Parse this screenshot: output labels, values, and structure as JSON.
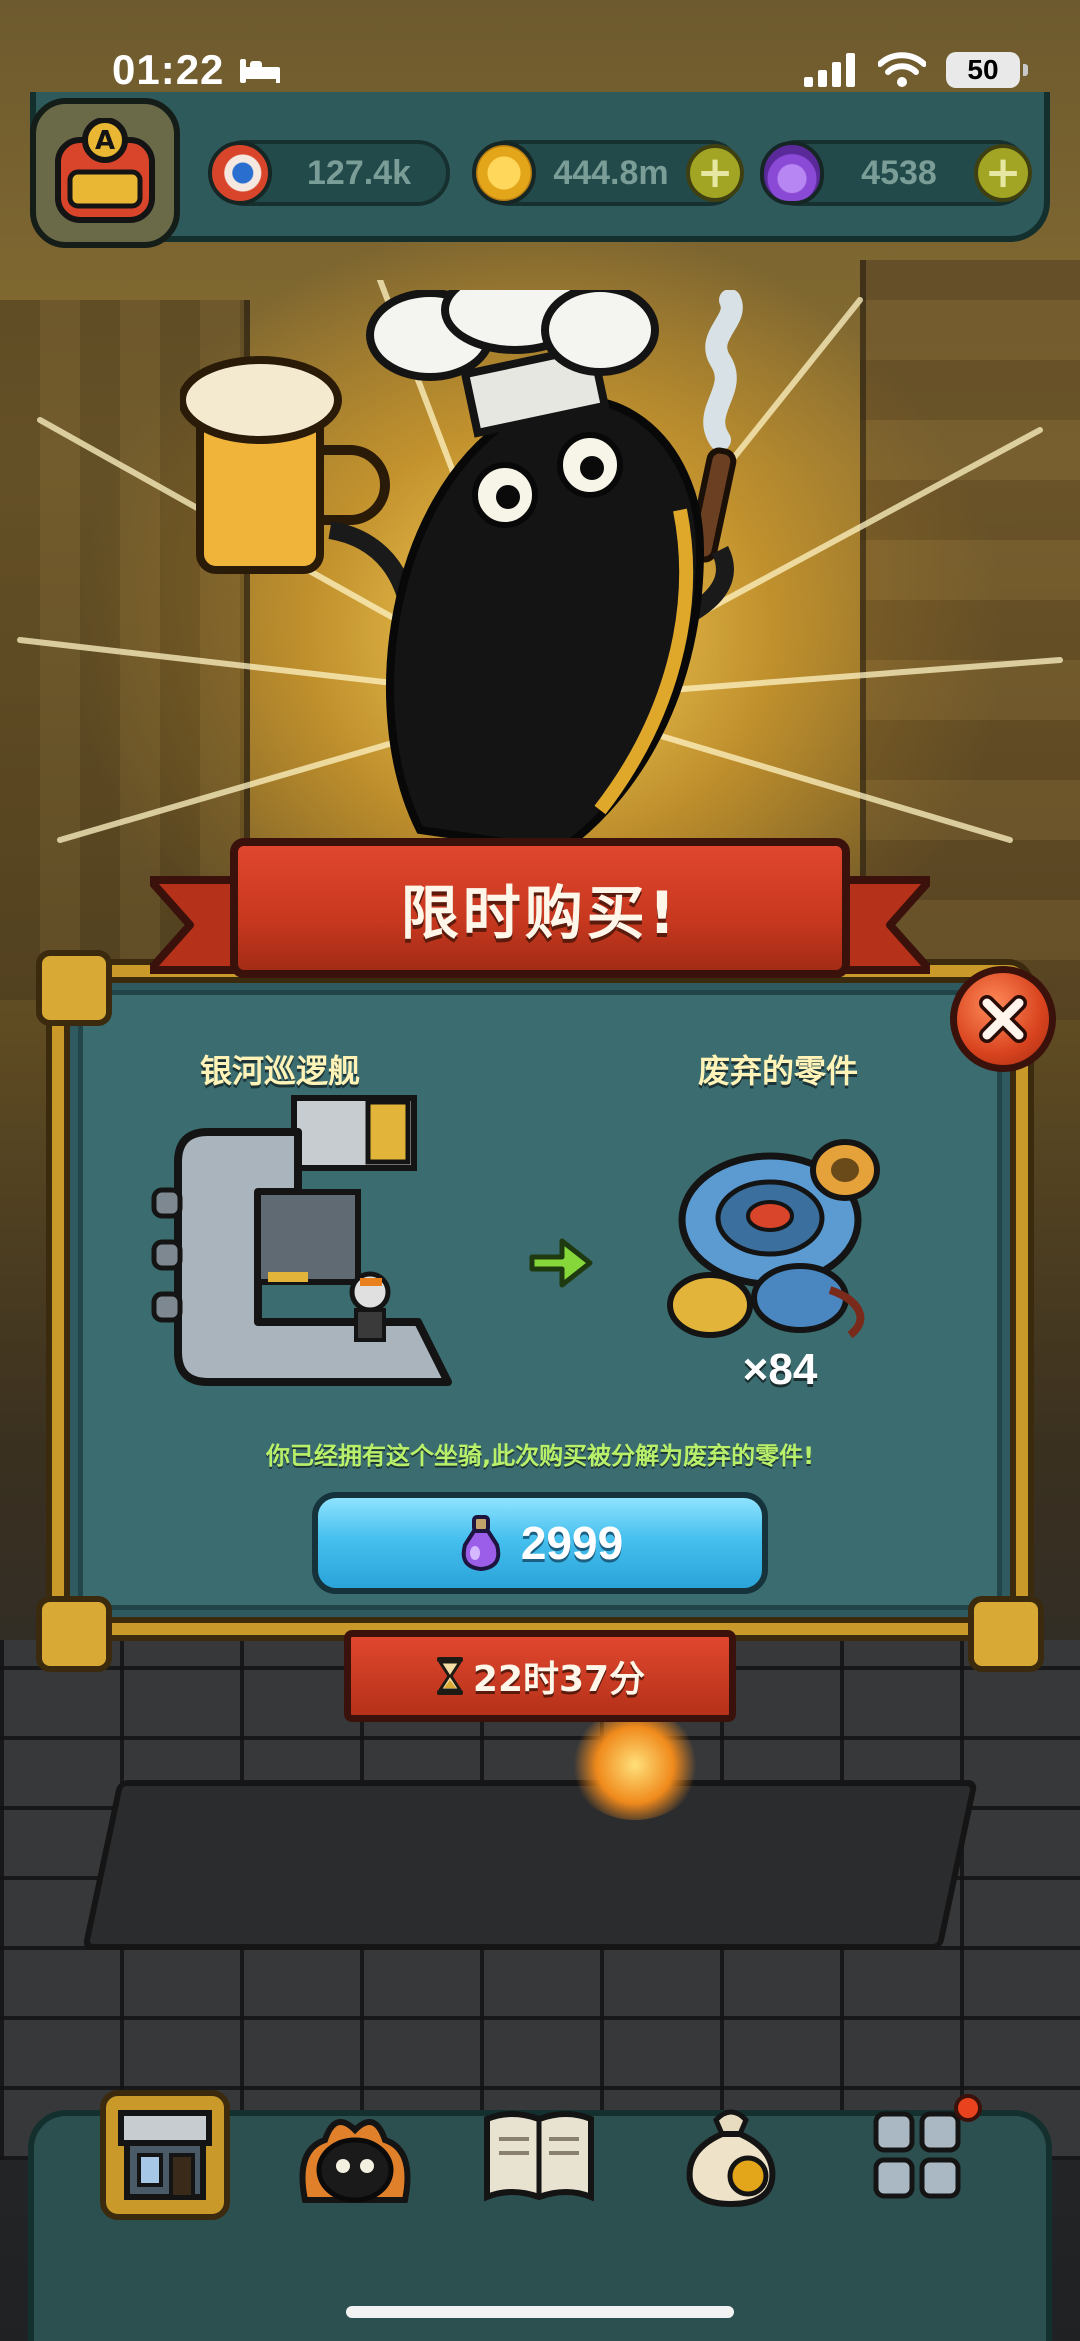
{
  "status_bar": {
    "time": "01:22",
    "battery": "50"
  },
  "resources": [
    {
      "id": "eyes",
      "value": "127.4k",
      "icon": "eyeball-icon",
      "color": "#d8452a",
      "has_plus": false
    },
    {
      "id": "coins",
      "value": "444.8m",
      "icon": "gold-coin-icon",
      "color": "#e3a61b",
      "has_plus": true
    },
    {
      "id": "potion",
      "value": "4538",
      "icon": "purple-potion-icon",
      "color": "#8a4ad6",
      "has_plus": true
    }
  ],
  "offer": {
    "title": "限时购买!",
    "item_name": "银河巡逻舰",
    "reward_name": "废弃的零件",
    "reward_quantity": "×84",
    "notice": "你已经拥有这个坐骑,此次购买被分解为废弃的零件!",
    "price": "2999",
    "price_icon": "purple-potion-icon",
    "timer": "22时37分",
    "timer_icon": "hourglass-icon"
  },
  "colors": {
    "banner_red": "#d8432a",
    "dialog_frame": "#c99a2a",
    "dialog_bg": "#3a6c70",
    "buy_button": "#46c0ee",
    "notice_green": "#b8f06a",
    "label_yellow": "#fff3b8"
  },
  "bottom_nav": [
    {
      "id": "shop",
      "icon": "shop-building-icon",
      "selected": true
    },
    {
      "id": "monsters",
      "icon": "monster-icon",
      "selected": false
    },
    {
      "id": "recipes",
      "icon": "book-icon",
      "selected": false
    },
    {
      "id": "bag",
      "icon": "money-bag-icon",
      "selected": false
    },
    {
      "id": "more",
      "icon": "grid-menu-icon",
      "selected": false,
      "badge": true
    }
  ]
}
